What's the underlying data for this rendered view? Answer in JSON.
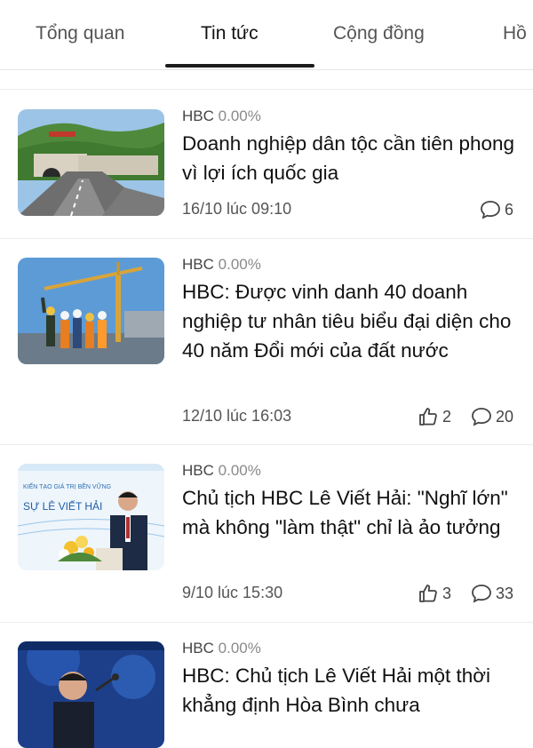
{
  "tabs": [
    {
      "label": "Tổng quan",
      "active": false
    },
    {
      "label": "Tin tức",
      "active": true
    },
    {
      "label": "Cộng đồng",
      "active": false
    },
    {
      "label": "Hồ",
      "active": false
    }
  ],
  "articles": [
    {
      "ticker": "HBC",
      "change": "0.00%",
      "title": "Doanh nghiệp dân tộc cần tiên phong vì lợi ích quốc gia",
      "date": "16/10 lúc 09:10",
      "likes": null,
      "comments": "6",
      "thumb_icon": "tunnel-highway-image"
    },
    {
      "ticker": "HBC",
      "change": "0.00%",
      "title": "HBC: Được vinh danh 40 doanh nghiệp tư nhân tiêu biểu đại diện cho 40 năm Đổi mới của đất nước",
      "date": "12/10 lúc 16:03",
      "likes": "2",
      "comments": "20",
      "thumb_icon": "construction-workers-image"
    },
    {
      "ticker": "HBC",
      "change": "0.00%",
      "title": "Chủ tịch HBC Lê Viết Hải: \"Nghĩ lớn\" mà không \"làm thật\" chỉ là ảo tưởng",
      "date": "9/10 lúc 15:30",
      "likes": "3",
      "comments": "33",
      "thumb_icon": "speaker-podium-image",
      "thumb_caption": "SỰ LÊ VIẾT HẢI"
    },
    {
      "ticker": "HBC",
      "change": "0.00%",
      "title": "HBC: Chủ tịch Lê Viết Hải một thời khẳng định Hòa Bình chưa",
      "thumb_icon": "speaker-microphone-image"
    }
  ],
  "colors": {
    "accent": "#1c1c1c",
    "muted": "#8a8a8a",
    "divider": "#ececec"
  }
}
